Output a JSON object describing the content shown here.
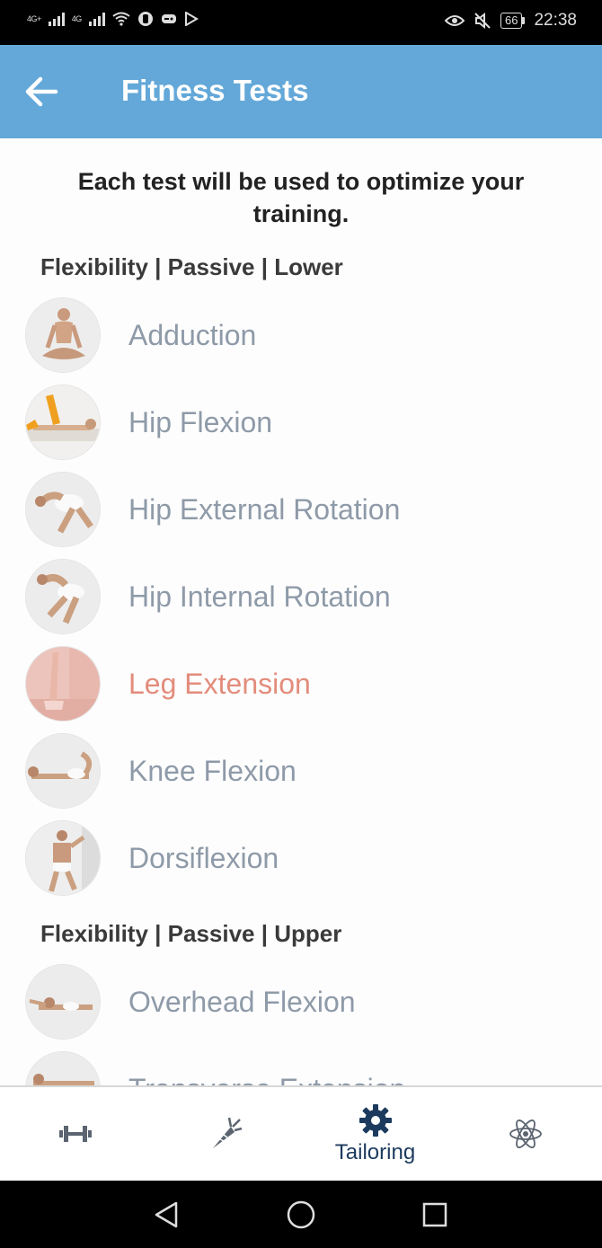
{
  "status_bar": {
    "signal_1": "4G+",
    "signal_2": "4G",
    "battery": "66",
    "time": "22:38"
  },
  "app_bar": {
    "title": "Fitness Tests",
    "background_color": "#63a8d8"
  },
  "intro_text": "Each test will be used to optimize your training.",
  "sections": [
    {
      "title": "Flexibility | Passive | Lower",
      "items": [
        {
          "label": "Adduction",
          "active": false
        },
        {
          "label": "Hip Flexion",
          "active": false
        },
        {
          "label": "Hip External Rotation",
          "active": false
        },
        {
          "label": "Hip Internal Rotation",
          "active": false
        },
        {
          "label": "Leg Extension",
          "active": true
        },
        {
          "label": "Knee Flexion",
          "active": false
        },
        {
          "label": "Dorsiflexion",
          "active": false
        }
      ]
    },
    {
      "title": "Flexibility | Passive | Upper",
      "items": [
        {
          "label": "Overhead Flexion",
          "active": false
        },
        {
          "label": "Transverse Extension",
          "active": false
        }
      ]
    }
  ],
  "bottom_nav": {
    "items": [
      {
        "icon": "dumbbell-icon",
        "label": ""
      },
      {
        "icon": "carrot-icon",
        "label": ""
      },
      {
        "icon": "gear-icon",
        "label": "Tailoring",
        "selected": true
      },
      {
        "icon": "atom-icon",
        "label": ""
      }
    ],
    "selected_color": "#1c3a5e"
  },
  "colors": {
    "label_default": "#8e9aa8",
    "label_active": "#e38c7c"
  }
}
